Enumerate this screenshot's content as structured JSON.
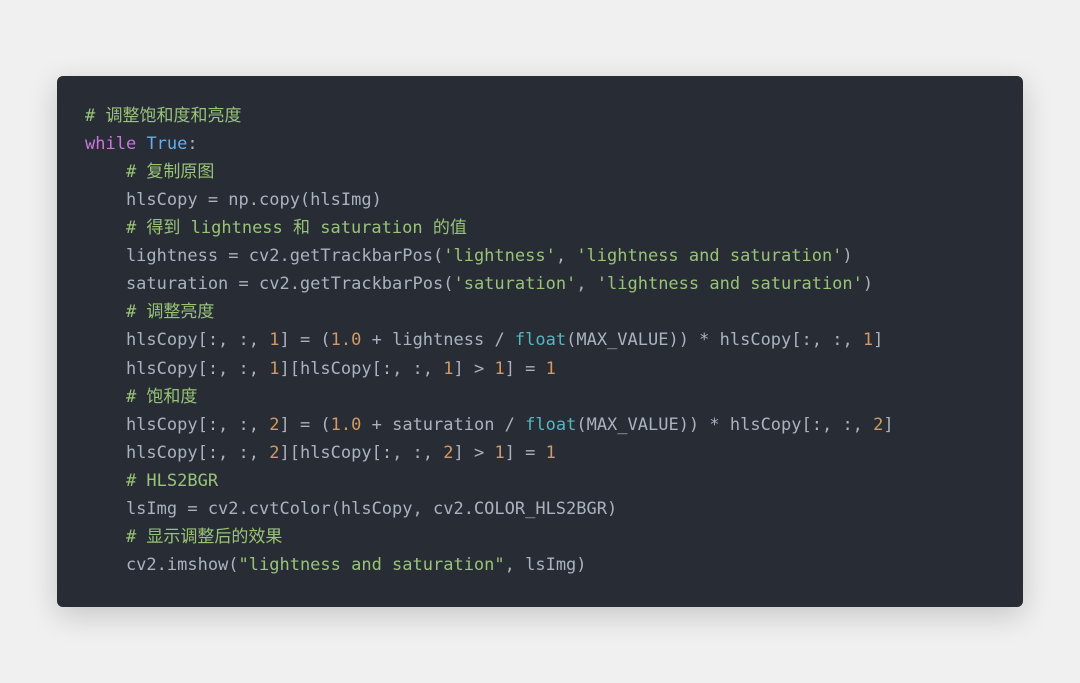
{
  "code": {
    "tokens": [
      [
        {
          "t": "# 调整饱和度和亮度",
          "cls": "c"
        }
      ],
      [
        {
          "t": "while",
          "cls": "k"
        },
        {
          "t": " ",
          "cls": "p"
        },
        {
          "t": "True",
          "cls": "kc"
        },
        {
          "t": ":",
          "cls": "p"
        }
      ],
      [
        {
          "t": "    ",
          "cls": "p"
        },
        {
          "t": "# 复制原图",
          "cls": "c"
        }
      ],
      [
        {
          "t": "    hlsCopy = np.copy(hlsImg)",
          "cls": "p"
        }
      ],
      [
        {
          "t": "    ",
          "cls": "p"
        },
        {
          "t": "# 得到 lightness 和 saturation 的值",
          "cls": "c"
        }
      ],
      [
        {
          "t": "    lightness = cv2.getTrackbarPos(",
          "cls": "p"
        },
        {
          "t": "'lightness'",
          "cls": "s"
        },
        {
          "t": ", ",
          "cls": "p"
        },
        {
          "t": "'lightness and saturation'",
          "cls": "s"
        },
        {
          "t": ")",
          "cls": "p"
        }
      ],
      [
        {
          "t": "    saturation = cv2.getTrackbarPos(",
          "cls": "p"
        },
        {
          "t": "'saturation'",
          "cls": "s"
        },
        {
          "t": ", ",
          "cls": "p"
        },
        {
          "t": "'lightness and saturation'",
          "cls": "s"
        },
        {
          "t": ")",
          "cls": "p"
        }
      ],
      [
        {
          "t": "    ",
          "cls": "p"
        },
        {
          "t": "# 调整亮度",
          "cls": "c"
        }
      ],
      [
        {
          "t": "    hlsCopy[:, :, ",
          "cls": "p"
        },
        {
          "t": "1",
          "cls": "m"
        },
        {
          "t": "] = (",
          "cls": "p"
        },
        {
          "t": "1.0",
          "cls": "m"
        },
        {
          "t": " + lightness / ",
          "cls": "p"
        },
        {
          "t": "float",
          "cls": "bi"
        },
        {
          "t": "(MAX_VALUE)) * hlsCopy[:, :, ",
          "cls": "p"
        },
        {
          "t": "1",
          "cls": "m"
        },
        {
          "t": "]",
          "cls": "p"
        }
      ],
      [
        {
          "t": "    hlsCopy[:, :, ",
          "cls": "p"
        },
        {
          "t": "1",
          "cls": "m"
        },
        {
          "t": "][hlsCopy[:, :, ",
          "cls": "p"
        },
        {
          "t": "1",
          "cls": "m"
        },
        {
          "t": "] > ",
          "cls": "p"
        },
        {
          "t": "1",
          "cls": "m"
        },
        {
          "t": "] = ",
          "cls": "p"
        },
        {
          "t": "1",
          "cls": "m"
        }
      ],
      [
        {
          "t": "    ",
          "cls": "p"
        },
        {
          "t": "# 饱和度",
          "cls": "c"
        }
      ],
      [
        {
          "t": "    hlsCopy[:, :, ",
          "cls": "p"
        },
        {
          "t": "2",
          "cls": "m"
        },
        {
          "t": "] = (",
          "cls": "p"
        },
        {
          "t": "1.0",
          "cls": "m"
        },
        {
          "t": " + saturation / ",
          "cls": "p"
        },
        {
          "t": "float",
          "cls": "bi"
        },
        {
          "t": "(MAX_VALUE)) * hlsCopy[:, :, ",
          "cls": "p"
        },
        {
          "t": "2",
          "cls": "m"
        },
        {
          "t": "]",
          "cls": "p"
        }
      ],
      [
        {
          "t": "    hlsCopy[:, :, ",
          "cls": "p"
        },
        {
          "t": "2",
          "cls": "m"
        },
        {
          "t": "][hlsCopy[:, :, ",
          "cls": "p"
        },
        {
          "t": "2",
          "cls": "m"
        },
        {
          "t": "] > ",
          "cls": "p"
        },
        {
          "t": "1",
          "cls": "m"
        },
        {
          "t": "] = ",
          "cls": "p"
        },
        {
          "t": "1",
          "cls": "m"
        }
      ],
      [
        {
          "t": "    ",
          "cls": "p"
        },
        {
          "t": "# HLS2BGR",
          "cls": "c"
        }
      ],
      [
        {
          "t": "    lsImg = cv2.cvtColor(hlsCopy, cv2.COLOR_HLS2BGR)",
          "cls": "p"
        }
      ],
      [
        {
          "t": "    ",
          "cls": "p"
        },
        {
          "t": "# 显示调整后的效果",
          "cls": "c"
        }
      ],
      [
        {
          "t": "    cv2.imshow(",
          "cls": "p"
        },
        {
          "t": "\"lightness and saturation\"",
          "cls": "s"
        },
        {
          "t": ", lsImg)",
          "cls": "p"
        }
      ]
    ]
  },
  "colors": {
    "background_page": "#f0f0f0",
    "background_code": "#282c34",
    "default_text": "#abb2bf",
    "comment": "#98c379",
    "keyword": "#c678dd",
    "constant_true": "#61afef",
    "string": "#98c379",
    "number": "#d19a66",
    "builtin": "#56b6c2"
  }
}
